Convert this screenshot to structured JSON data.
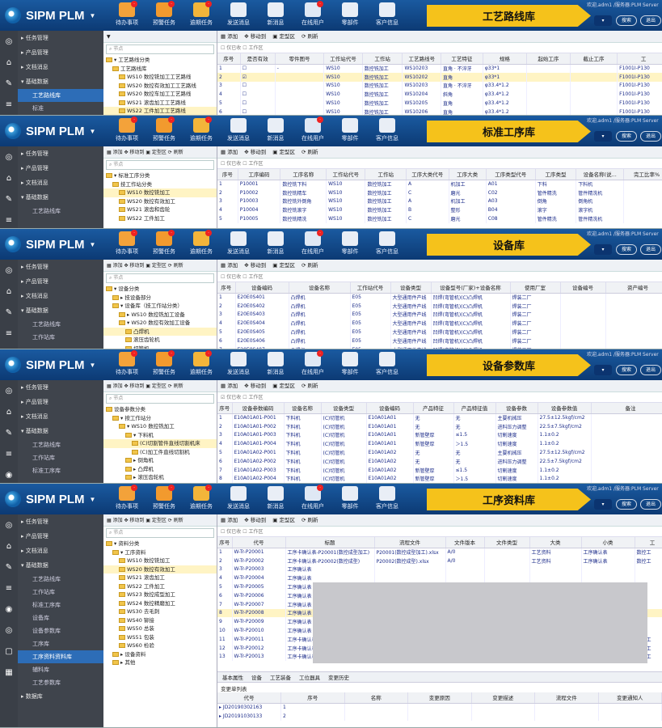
{
  "app": {
    "name": "SIPM PLM",
    "caret": "▼"
  },
  "toolbar_buttons": [
    {
      "label": "待办事项",
      "icon": "todo-icon",
      "color": "#f3a23a",
      "badge": ""
    },
    {
      "label": "预警任务",
      "icon": "warning-task-icon",
      "color": "#f29a2e",
      "badge": ""
    },
    {
      "label": "逾期任务",
      "icon": "overdue-task-icon",
      "color": "#f3b53a",
      "badge": ""
    },
    {
      "label": "发送消息",
      "icon": "send-message-icon",
      "color": "#e9eef6",
      "badge": ""
    },
    {
      "label": "新消息",
      "icon": "new-message-icon",
      "color": "#e9eef6",
      "badge": ""
    },
    {
      "label": "在线用户",
      "icon": "online-users-icon",
      "color": "#dfe8f4",
      "badge": ""
    },
    {
      "label": "零部件",
      "icon": "parts-icon",
      "color": "#e9eef6",
      "badge": ""
    },
    {
      "label": "客户信息",
      "icon": "customer-icon",
      "color": "#e9eef6",
      "badge": ""
    }
  ],
  "header_right": {
    "user": "欢迎,adm1 /服务器:PLM Server",
    "search": "搜索",
    "logout": "退出"
  },
  "panels": [
    {
      "banner": "工艺路线库",
      "side": [
        {
          "label": "▸ 任务管理"
        },
        {
          "label": "▸ 产品管理"
        },
        {
          "label": "▸ 文档消息"
        },
        {
          "label": "▾ 基础数据"
        },
        {
          "label": "工艺路线库",
          "sub": true,
          "active": true
        },
        {
          "label": "标准",
          "sub": true
        }
      ],
      "tree_toolbar": "▼",
      "tree": [
        {
          "t": "▾ 工艺路线分类",
          "d": 0
        },
        {
          "t": "工艺路线库",
          "d": 1
        },
        {
          "t": "WS10 数控铣加工工艺路线",
          "d": 2
        },
        {
          "t": "WS20 数控有效加工工艺路线",
          "d": 2
        },
        {
          "t": "WS20 数控车加工工艺路线",
          "d": 2
        },
        {
          "t": "WS21 滚齿加工工艺路线",
          "d": 2
        },
        {
          "t": "WS22 工件加工工艺路线",
          "d": 2,
          "sel": true
        }
      ],
      "toolbar": [
        "▦ 添加",
        "✥ 移动到",
        "▣ 定型区",
        "⟳ 刷新"
      ],
      "options": "☐ 仅已收 ☐ 工作区",
      "cols": [
        "序号",
        "是否有效",
        "零件图号",
        "工作站代号",
        "工作站",
        "工艺路线号",
        "工艺特征",
        "规格",
        "起始工序",
        "截止工序",
        "工"
      ],
      "widths": [
        26,
        40,
        56,
        44,
        46,
        44,
        48,
        50,
        50,
        54,
        60
      ],
      "rows": [
        [
          "1",
          "☐",
          "-",
          "WS10",
          "数控铣加工",
          "WS10203",
          "直角 · 不淬牙",
          "φ33*1",
          "",
          "",
          "F1001I-P130"
        ],
        [
          "2",
          "☑",
          "",
          "WS10",
          "数控铣加工",
          "WS10202",
          "直角",
          "φ33*1",
          "",
          "",
          "F1001I-P130"
        ],
        [
          "3",
          "☐",
          "",
          "WS10",
          "数控铣加工",
          "WS10203",
          "直角 · 不淬牙",
          "φ33.4*1.2",
          "",
          "",
          "F1001I-P130"
        ],
        [
          "4",
          "☐",
          "",
          "WS10",
          "数控铣加工",
          "WS10204",
          "斜角",
          "φ33.4*1.2",
          "",
          "",
          "F1001I-P130"
        ],
        [
          "5",
          "☐",
          "",
          "WS10",
          "数控铣加工",
          "WS10205",
          "直角",
          "φ33.4*1.2",
          "",
          "",
          "F1001I-P130"
        ],
        [
          "6",
          "☐",
          "",
          "WS10",
          "数控铣加工",
          "WS10206",
          "直角",
          "φ33.4*1.2",
          "",
          "",
          "F1001I-P130"
        ]
      ],
      "hl": [
        1
      ]
    },
    {
      "banner": "标准工序库",
      "side": [
        {
          "label": "▸ 任务管理"
        },
        {
          "label": "▸ 产品管理"
        },
        {
          "label": "▸ 文档消息"
        },
        {
          "label": "▾ 基础数据"
        },
        {
          "label": "工艺路线库",
          "sub": true
        }
      ],
      "tree_toolbar": "▦ 添加 ✥ 移动到 ▣ 定型区 ⟳ 刷新",
      "tree": [
        {
          "t": "▾ 标准工序分类",
          "d": 0
        },
        {
          "t": "技工作站分类",
          "d": 1
        },
        {
          "t": "WS10 数控铣加工",
          "d": 2,
          "sel": true
        },
        {
          "t": "WS20 数控有效加工",
          "d": 2
        },
        {
          "t": "WS21 滚齿和齿轮",
          "d": 2
        },
        {
          "t": "WS22 工件加工",
          "d": 2
        }
      ],
      "toolbar": [
        "▦ 添加",
        "✥ 移动到",
        "▣ 定型区",
        "⟳ 刷新"
      ],
      "options": "☐ 仅已收 ☐ 工作区",
      "cols": [
        "序号",
        "工序编码",
        "工序名称",
        "工作站代号",
        "工作站",
        "工序大类代号",
        "工序大类",
        "工序类型代号",
        "工序类型",
        "设备名称(说...",
        "完工比率%"
      ],
      "widths": [
        24,
        50,
        54,
        46,
        48,
        50,
        44,
        58,
        48,
        56,
        54
      ],
      "rows": [
        [
          "1",
          "P10001",
          "数控铣下料",
          "WS10",
          "数控铣加工",
          "A",
          "机加工",
          "A01",
          "下料",
          "下料机",
          ""
        ],
        [
          "2",
          "P10002",
          "数控铣精车",
          "WS10",
          "数控铣加工",
          "C",
          "磨光",
          "C02",
          "管件精洗",
          "管件精洗机",
          ""
        ],
        [
          "3",
          "P10003",
          "数控铣外倒角",
          "WS10",
          "数控铣加工",
          "A",
          "机加工",
          "A03",
          "倒角",
          "倒角机",
          ""
        ],
        [
          "4",
          "P10004",
          "数控铣滚字",
          "WS10",
          "数控铣加工",
          "B",
          "整形",
          "B04",
          "滚字",
          "滚字机",
          ""
        ],
        [
          "5",
          "P10005",
          "数控铣精洗",
          "WS10",
          "数控铣加工",
          "C",
          "磨光",
          "C08",
          "管件精洗",
          "管件精洗机",
          ""
        ]
      ],
      "hl": []
    },
    {
      "banner": "设备库",
      "side": [
        {
          "label": "▸ 任务管理"
        },
        {
          "label": "▸ 产品管理"
        },
        {
          "label": "▸ 文档消息"
        },
        {
          "label": "▾ 基础数据"
        },
        {
          "label": "工艺路线库",
          "sub": true
        },
        {
          "label": "工作站库",
          "sub": true
        }
      ],
      "tree_toolbar": "▦ 添加 ✥ 移动到 ▣ 定型区 ⟳ 刷新",
      "tree": [
        {
          "t": "▾ 设备分类",
          "d": 0
        },
        {
          "t": "▸ 技设备部分",
          "d": 1
        },
        {
          "t": "▾ 设备库（技工作站分类）",
          "d": 1
        },
        {
          "t": "▸ WS10 数控铣加工设备",
          "d": 2
        },
        {
          "t": "▾ WS20 数控有效加工设备",
          "d": 2
        },
        {
          "t": "凸焊机",
          "d": 3,
          "sel": true
        },
        {
          "t": "滚压齿轮机",
          "d": 3
        },
        {
          "t": "切管机",
          "d": 3
        }
      ],
      "toolbar": [
        "▦ 添加",
        "✥ 移动到",
        "▣ 定型区",
        "⟳ 刷新"
      ],
      "options": "☐ 仅已收 ☐ 工作区",
      "cols": [
        "序号",
        "设备编码",
        "设备名称",
        "工作站代号",
        "设备类型",
        "设备型号(厂家)+设备名称",
        "使用厂室",
        "设备编号",
        "资产编号"
      ],
      "widths": [
        22,
        66,
        76,
        50,
        50,
        98,
        62,
        56,
        80
      ],
      "rows": [
        [
          "1",
          "E20E0S401",
          "凸焊机",
          "E05",
          "大型通用件产线",
          "凹焊(弯管机)(C)凸焊机",
          "焊装二厂",
          "",
          ""
        ],
        [
          "2",
          "E20E0S402",
          "凸焊机",
          "E05",
          "大型通用件产线",
          "凹焊(弯管机)(C)凸焊机",
          "焊装二厂",
          "",
          ""
        ],
        [
          "3",
          "E20E0S403",
          "凸焊机",
          "E05",
          "大型通用件产线",
          "凹焊(弯管机)(C)凸焊机",
          "焊装二厂",
          "",
          ""
        ],
        [
          "4",
          "E20E0S404",
          "凸焊机",
          "E05",
          "大型通用件产线",
          "凹焊(弯管机)(C)凸焊机",
          "焊装二厂",
          "",
          ""
        ],
        [
          "5",
          "E20E0S405",
          "凸焊机",
          "E05",
          "大型通用件产线",
          "凹焊(弯管机)(C)凸焊机",
          "焊装二厂",
          "",
          ""
        ],
        [
          "6",
          "E20E0S406",
          "凸焊机",
          "E05",
          "大型通用件产线",
          "凹焊(弯管机)(C)凸焊机",
          "焊装二厂",
          "",
          ""
        ],
        [
          "7",
          "E20E0S407",
          "凸焊机",
          "E05",
          "大型通用件产线",
          "凹焊(弯管机)(C)凸焊机",
          "焊装二厂",
          "",
          ""
        ]
      ],
      "hl": []
    },
    {
      "banner": "设备参数库",
      "side": [
        {
          "label": "▸ 任务管理"
        },
        {
          "label": "▸ 产品管理"
        },
        {
          "label": "▸ 文档消息"
        },
        {
          "label": "▾ 基础数据"
        },
        {
          "label": "工艺路线库",
          "sub": true
        },
        {
          "label": "工作站库",
          "sub": true
        },
        {
          "label": "标准工序库",
          "sub": true
        }
      ],
      "tree_toolbar": "▦ 添加 ✥ 移动到 ▣ 定型区 ⟳ 刷新",
      "tree": [
        {
          "t": "设备参数分类",
          "d": 0
        },
        {
          "t": "▾ 按工作站分",
          "d": 1
        },
        {
          "t": "▾ WS10 数控铣加工",
          "d": 2
        },
        {
          "t": "▾ 下料机",
          "d": 3
        },
        {
          "t": "(C)切割管件直线切割机床",
          "d": 4,
          "sel": true
        },
        {
          "t": "(C)加工件直线切割机",
          "d": 4
        },
        {
          "t": "▸ 倒角机",
          "d": 3
        },
        {
          "t": "▸ 凸焊机",
          "d": 3
        },
        {
          "t": "▸ 滚压齿轮机",
          "d": 3
        }
      ],
      "toolbar": [
        "▦ 添加",
        "✥ 移动到",
        "▣ 定型区",
        "⟳ 刷新"
      ],
      "options": "☑ 仅已收 ☐ 工作区",
      "cols": [
        "序号",
        "设备参数编码",
        "设备名称",
        "设备类型",
        "设备编码",
        "产品特征",
        "产品特征值",
        "设备参数",
        "设备参数值",
        "备注"
      ],
      "widths": [
        18,
        64,
        46,
        56,
        58,
        50,
        52,
        52,
        66,
        98
      ],
      "rows": [
        [
          "1",
          "E10A01A01-P001",
          "下料机",
          "(C)切管机",
          "E10A01A01",
          "无",
          "无",
          "主要机械压",
          "27.5±12.5kgf/cm2",
          ""
        ],
        [
          "2",
          "E10A01A01-P002",
          "下料机",
          "(C)切管机",
          "E10A01A01",
          "无",
          "无",
          "进料压力调整",
          "22.5±7.5kgf/cm2",
          ""
        ],
        [
          "3",
          "E10A01A01-P003",
          "下料机",
          "(C)切管机",
          "E10A01A01",
          "新管壁厚",
          "≤1.5",
          "切割速度",
          "1.1±0.2",
          ""
        ],
        [
          "4",
          "E10A01A01-P004",
          "下料机",
          "(C)切管机",
          "E10A01A01",
          "新管壁厚",
          "＞1.5",
          "切割速度",
          "1.1±0.2",
          ""
        ],
        [
          "5",
          "E10A01A02-P001",
          "下料机",
          "(C)切管机",
          "E10A01A02",
          "无",
          "无",
          "主要机械压",
          "27.5±12.5kgf/cm2",
          ""
        ],
        [
          "6",
          "E10A01A02-P002",
          "下料机",
          "(C)切管机",
          "E10A01A02",
          "无",
          "无",
          "进料压力调整",
          "22.5±7.5kgf/cm2",
          ""
        ],
        [
          "7",
          "E10A01A02-P003",
          "下料机",
          "(C)切管机",
          "E10A01A02",
          "新管壁厚",
          "≤1.5",
          "切割速度",
          "1.1±0.2",
          ""
        ],
        [
          "8",
          "E10A01A02-P004",
          "下料机",
          "(C)切管机",
          "E10A01A02",
          "新管壁厚",
          "＞1.5",
          "切割速度",
          "1.1±0.2",
          ""
        ]
      ],
      "hl": []
    },
    {
      "banner": "工序资料库",
      "side": [
        {
          "label": "▸ 任务管理"
        },
        {
          "label": "▸ 产品管理"
        },
        {
          "label": "▸ 文档消息"
        },
        {
          "label": "▾ 基础数据"
        },
        {
          "label": "工艺路线库",
          "sub": true
        },
        {
          "label": "工作站库",
          "sub": true
        },
        {
          "label": "标准工序库",
          "sub": true
        },
        {
          "label": "设备库",
          "sub": true
        },
        {
          "label": "设备参数库",
          "sub": true
        },
        {
          "label": "工序库",
          "sub": true
        },
        {
          "label": "工序资料资料库",
          "sub": true,
          "active": true
        },
        {
          "label": "辅料库",
          "sub": true
        },
        {
          "label": "工艺参数库",
          "sub": true
        },
        {
          "label": "▸ 数据库",
          "sub": false
        }
      ],
      "tree_toolbar": "▦ 添加 ✥ 移动到 ▣ 定型区 ⟳ 刷新",
      "tree": [
        {
          "t": "▾ 资料分类",
          "d": 0
        },
        {
          "t": "▾ 工序资料",
          "d": 1
        },
        {
          "t": "WS10 数控铣加工",
          "d": 2
        },
        {
          "t": "WS20 数控有效加工",
          "d": 2,
          "sel": true
        },
        {
          "t": "WS21 滚齿加工",
          "d": 2
        },
        {
          "t": "WS22 工件加工",
          "d": 2
        },
        {
          "t": "WS23 数控成型加工",
          "d": 2
        },
        {
          "t": "WS24 数控精磨加工",
          "d": 2
        },
        {
          "t": "WS30 去毛刺",
          "d": 2
        },
        {
          "t": "WS40 铆接",
          "d": 2
        },
        {
          "t": "WS50 总装",
          "d": 2
        },
        {
          "t": "WS51 包装",
          "d": 2
        },
        {
          "t": "WS60 检验",
          "d": 2
        },
        {
          "t": "▸ 设备资料",
          "d": 1
        },
        {
          "t": "▸ 其他",
          "d": 1
        }
      ],
      "toolbar": [
        "▦ 添加",
        "✥ 移动到",
        "▣ 定型区",
        "⟳ 刷新"
      ],
      "options": "☐ 仅已收 ☐ 工作区",
      "cols": [
        "序号",
        "代号",
        "标题",
        "流程文件",
        "文件版本",
        "文件类型",
        "大类",
        "小类",
        "工"
      ],
      "widths": [
        18,
        66,
        110,
        88,
        48,
        56,
        64,
        66,
        44
      ],
      "rows": [
        [
          "1",
          "W-Tr-P20001",
          "工序卡确认表-P20001(数控成型加工)",
          "P20001(数控成型加工).xlsx",
          "A/0",
          "",
          "工艺资料",
          "工序确认表",
          "数控工"
        ],
        [
          "2",
          "W-Tr-P20002",
          "工序卡确认表-P20002(数控成型)",
          "P20002(数控成型).xlsx",
          "A/0",
          "",
          "工艺资料",
          "工序确认表",
          "数控工"
        ],
        [
          "3",
          "W-Tr-P20003",
          "工序确认表",
          "",
          "",
          "",
          "",
          "",
          ""
        ],
        [
          "4",
          "W-Tr-P20004",
          "工序确认表",
          "",
          "",
          "",
          "",
          "",
          ""
        ],
        [
          "5",
          "W-Tr-P20005",
          "工序确认表",
          "",
          "",
          "",
          "",
          "",
          ""
        ],
        [
          "6",
          "W-Tr-P20006",
          "工序确认表",
          "",
          "",
          "",
          "",
          "",
          ""
        ],
        [
          "7",
          "W-Tr-P20007",
          "工序确认表",
          "",
          "",
          "",
          "",
          "",
          ""
        ],
        [
          "8",
          "W-Tr-P20008",
          "工序确认表",
          "",
          "",
          "",
          "",
          "",
          ""
        ],
        [
          "9",
          "W-Tr-P20009",
          "工序确认表",
          "",
          "",
          "",
          "",
          "",
          ""
        ],
        [
          "10",
          "W-Tr-P20010",
          "工序确认表",
          "",
          "",
          "",
          "",
          "",
          ""
        ],
        [
          "11",
          "W-Tr-P20011",
          "工序卡确认表-P20011(数控成型)",
          "P20011(数控成型).xlsx",
          "A/0",
          "",
          "工艺资料",
          "工序确认表",
          "数控工"
        ],
        [
          "12",
          "W-Tr-P20012",
          "工序卡确认表-P20012(数控成型)",
          "P20012(数控成型).xlsx",
          "A/0",
          "",
          "工艺资料",
          "工序确认表",
          "数控工"
        ],
        [
          "13",
          "W-Tr-P20013",
          "工序卡确认表-P20013(数控成型)",
          "P20013(数控成型).xlsx",
          "A/0",
          "",
          "工艺资料",
          "工序确认表",
          "数控工"
        ]
      ],
      "hl": [
        7
      ],
      "subtabs": [
        "基本属性",
        "设备",
        "工艺装备",
        "工位器具",
        "变更历史"
      ],
      "history_title": "变更单列表",
      "history_cols": [
        "代号",
        "序号",
        "名称",
        "变更原因",
        "变更描述",
        "流程文件",
        "变更通知人"
      ],
      "history_rows": [
        [
          "▸ JD20190302163",
          "1",
          "",
          "",
          "",
          "",
          ""
        ],
        [
          "▸ JD20191030133",
          "2",
          "",
          "",
          "",
          "",
          ""
        ]
      ]
    }
  ]
}
